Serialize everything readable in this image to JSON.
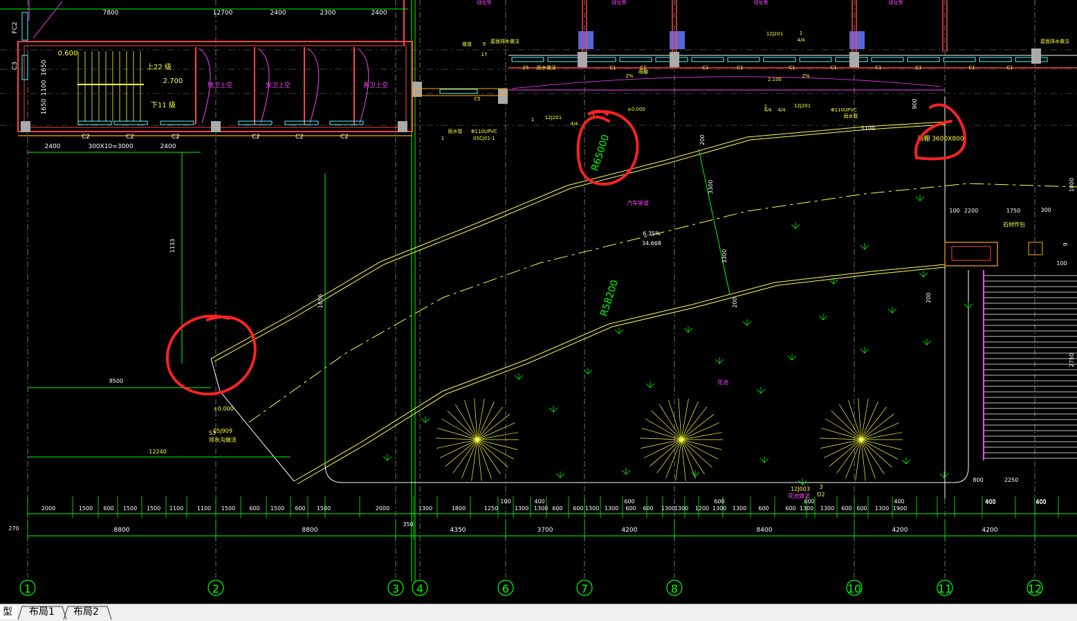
{
  "tabs": [
    "型",
    "布局1",
    "布局2"
  ],
  "axis_labels": [
    "1",
    "2",
    "3",
    "4",
    "6",
    "7",
    "8",
    "10",
    "11",
    "12"
  ],
  "top_dims": [
    "7800",
    "12700",
    "2400",
    "2300",
    "2400"
  ],
  "left_dims": [
    "FC2",
    "C3",
    "1650",
    "1100",
    "1650"
  ],
  "room_labels": [
    "残卫上空",
    "女卫上空",
    "男卫上空"
  ],
  "stair_labels": [
    "上22 级",
    "下11 级",
    "0.600",
    "2.700"
  ],
  "bottom_window_labels": [
    "C2",
    "C2",
    "C2",
    "C2",
    "C2",
    "C2"
  ],
  "under_building_dims": [
    "2400",
    "300X10=3000",
    "2400"
  ],
  "upper_labels": [
    "绿化带",
    "绿化带",
    "绿化带",
    "绿化带",
    "坡道",
    "9",
    "17",
    "12J201",
    "1",
    "4/4",
    "2%",
    "2%",
    "雨棚",
    "2.100",
    "±0.000",
    "12J201",
    "1",
    "4/4",
    "1",
    "4/4",
    "12J201",
    "1",
    "4/4",
    "Φ110UPVC",
    "雨水管",
    "雨水管",
    "Φ110UPVC",
    "05CJ01-1",
    "1",
    "25",
    "防水做法",
    "C1",
    "C1",
    "C1",
    "C1",
    "C1",
    "C1",
    "C1",
    "C1",
    "C1",
    "C1",
    "C5",
    "屋面排水做法",
    "屋面排水做法"
  ],
  "ramp_labels": [
    "R65000",
    "R58200",
    "汽车坡道",
    "6.35%",
    "34.668",
    "3300",
    "3300",
    "200",
    "200",
    "200",
    "1656",
    "1100",
    "900",
    "1133",
    "8500",
    "12240",
    "±0.000",
    "05J909",
    "S3",
    "排水沟做法",
    "花池",
    "12J003",
    "3",
    "D2",
    "花池做法"
  ],
  "right_labels": [
    "100",
    "2200",
    "1750",
    "300",
    "石材作包",
    "100",
    "800",
    "2250",
    "9",
    "400",
    "600",
    "2750",
    "1000"
  ],
  "dim_row_1": [
    "2000",
    "1500",
    "600",
    "1500",
    "1500",
    "1100",
    "1100",
    "1500",
    "600",
    "1500",
    "600",
    "1500",
    "2000",
    "1300",
    "1800",
    "1250",
    "1300",
    "1300",
    "600",
    "600",
    "1300",
    "1300",
    "600",
    "600",
    "1300",
    "1300",
    "1200",
    "1300",
    "1300",
    "600",
    "600",
    "1300",
    "1300",
    "600",
    "600",
    "1300",
    "1900"
  ],
  "dim_small": [
    "100",
    "400",
    "600",
    "600",
    "600",
    "400",
    "600",
    "400"
  ],
  "dim_row_2": [
    "8800",
    "8800",
    "4350",
    "3700",
    "4200",
    "8400",
    "4200",
    "4200"
  ],
  "dim_side": [
    "270",
    "350"
  ],
  "highlight_label": "雨棚 3600X800",
  "colors": {
    "background": "#000000",
    "grid": "#00ff00",
    "wall": "#ff4444",
    "wall_alt": "#ffaa00",
    "yellow": "#ffff44",
    "magenta": "#ff44ff",
    "cyan": "#44ffff",
    "white": "#ffffff",
    "markup": "#ff2222"
  }
}
